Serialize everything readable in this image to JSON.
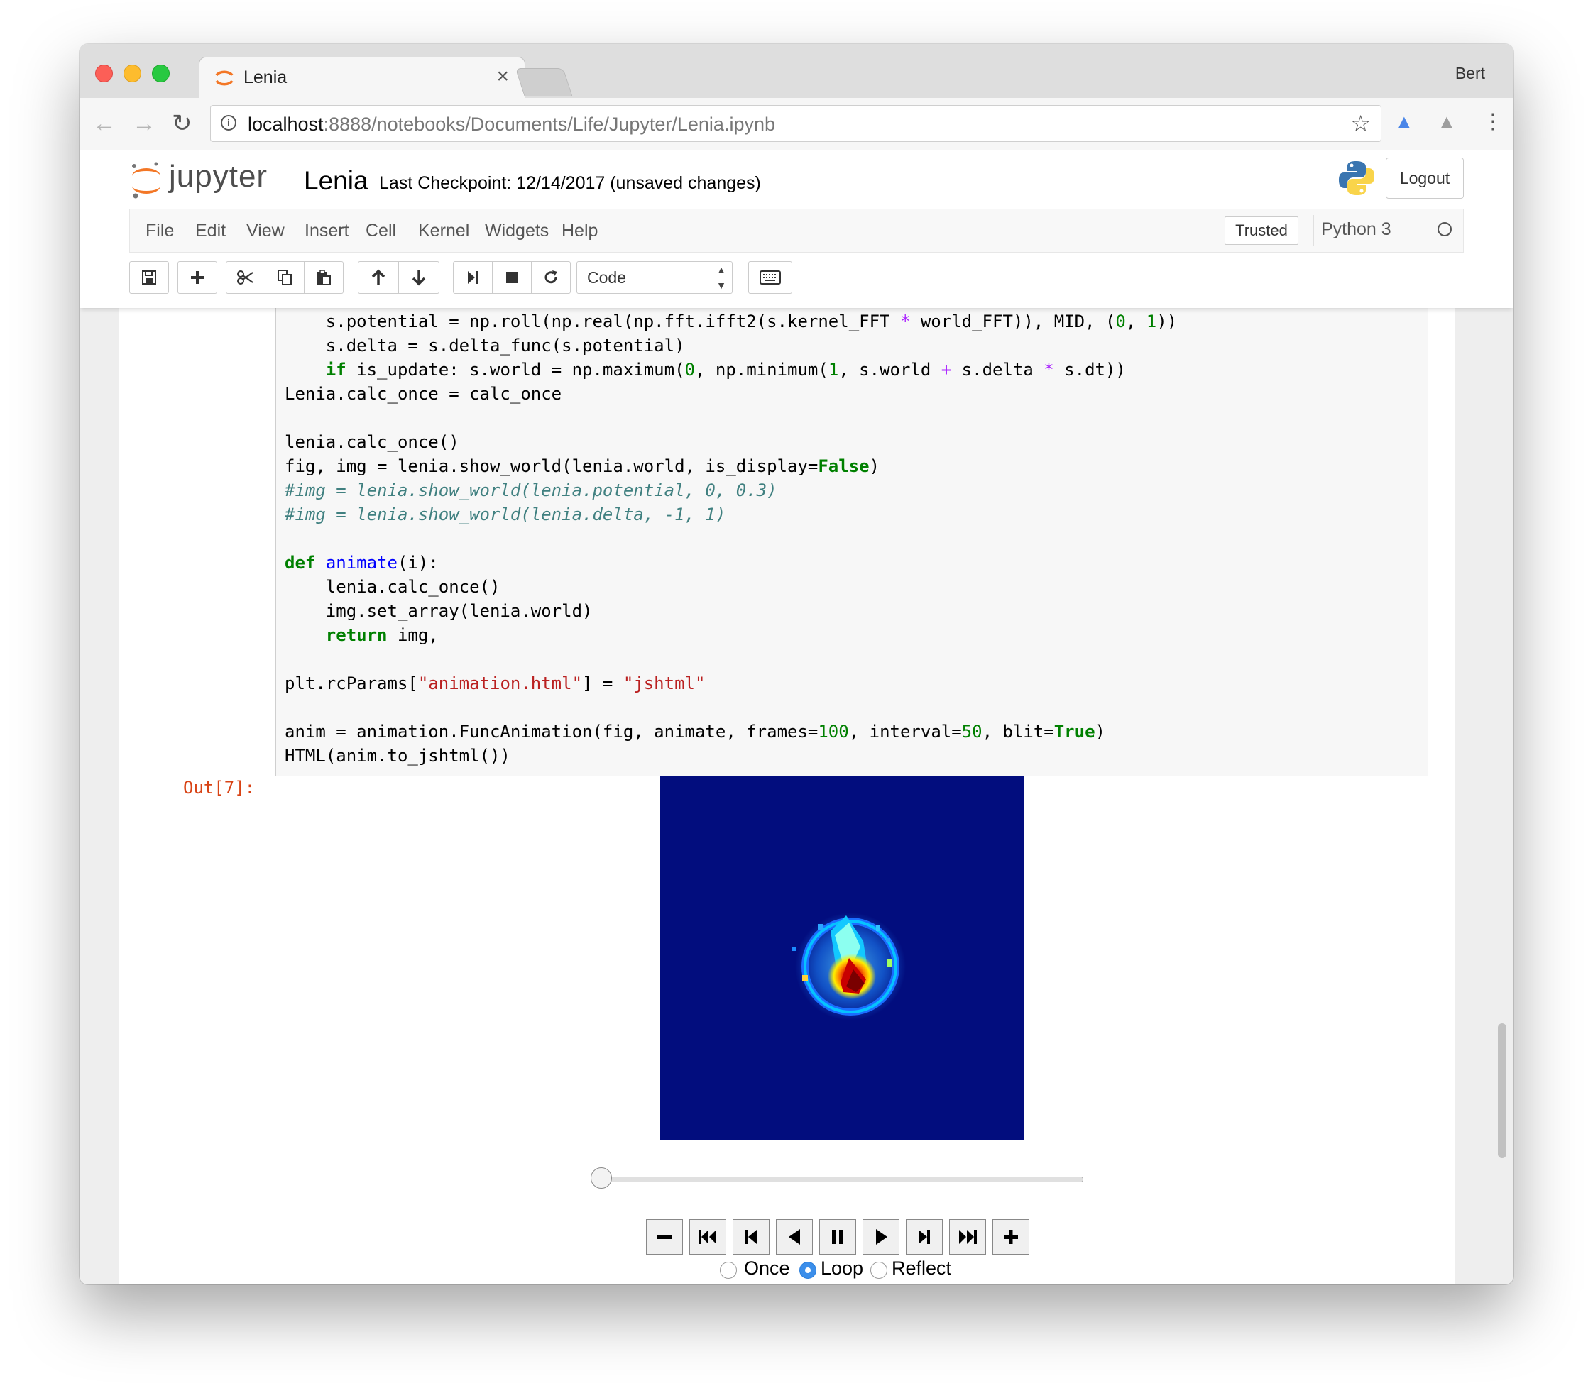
{
  "browser": {
    "tab_title": "Lenia",
    "tab_close": "×",
    "profile_name": "Bert",
    "url_host": "localhost",
    "url_path": ":8888/notebooks/Documents/Life/Jupyter/Lenia.ipynb"
  },
  "jupyter": {
    "logo_text": "jupyter",
    "notebook_name": "Lenia",
    "checkpoint": "Last Checkpoint: 12/14/2017 (unsaved changes)",
    "logout_label": "Logout",
    "menu": [
      "File",
      "Edit",
      "View",
      "Insert",
      "Cell",
      "Kernel",
      "Widgets",
      "Help"
    ],
    "trusted_label": "Trusted",
    "kernel_name": "Python 3",
    "cell_type": "Code"
  },
  "toolbar_icons": [
    "save-icon",
    "plus-icon",
    "cut-icon",
    "copy-icon",
    "paste-icon",
    "arrow-up-icon",
    "arrow-down-icon",
    "step-forward-icon",
    "stop-icon",
    "refresh-icon",
    "keyboard-icon"
  ],
  "cell": {
    "code_lines": [
      "    s.potential = np.roll(np.real(np.fft.ifft2(s.kernel_FFT * world_FFT)), MID, (0, 1))",
      "    s.delta = s.delta_func(s.potential)",
      "    if is_update: s.world = np.maximum(0, np.minimum(1, s.world + s.delta * s.dt))",
      "Lenia.calc_once = calc_once",
      "",
      "lenia.calc_once()",
      "fig, img = lenia.show_world(lenia.world, is_display=False)",
      "#img = lenia.show_world(lenia.potential, 0, 0.3)",
      "#img = lenia.show_world(lenia.delta, -1, 1)",
      "",
      "def animate(i):",
      "    lenia.calc_once()",
      "    img.set_array(lenia.world)",
      "    return img,",
      "",
      "plt.rcParams[\"animation.html\"] = \"jshtml\"",
      "",
      "anim = animation.FuncAnimation(fig, animate, frames=100, interval=50, blit=True)",
      "HTML(anim.to_jshtml())"
    ],
    "out_prompt": "Out[7]:"
  },
  "animation": {
    "frame_position": 0,
    "controls": [
      "minus-icon",
      "first-frame-icon",
      "previous-frame-icon",
      "reverse-play-icon",
      "pause-icon",
      "play-icon",
      "next-frame-icon",
      "last-frame-icon",
      "plus-icon"
    ],
    "loop_modes": [
      "Once",
      "Loop",
      "Reflect"
    ],
    "selected_mode": "Loop",
    "background_color": "#020d7e"
  }
}
